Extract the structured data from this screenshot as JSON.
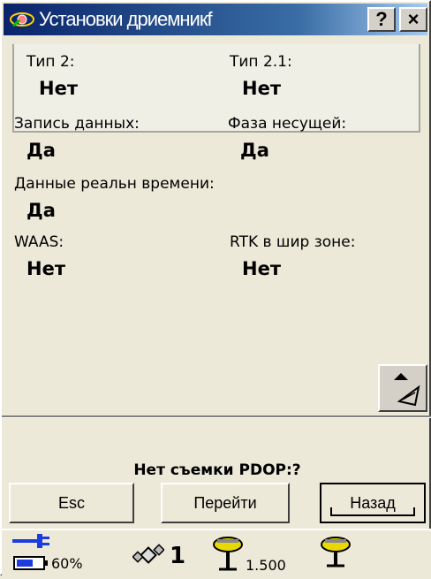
{
  "window": {
    "title": "Установки дриемникf",
    "help_label": "?",
    "close_label": "×"
  },
  "fields": {
    "type2": {
      "label": "Тип 2:",
      "value": "Нет"
    },
    "type21": {
      "label": "Тип 2.1:",
      "value": "Нет"
    },
    "data_logging": {
      "label": "Запись данных:",
      "value": "Да"
    },
    "carrier_phase": {
      "label": "Фаза несущей:",
      "value": "Да"
    },
    "realtime_data": {
      "label": "Данные реальн времени:",
      "value": "Да"
    },
    "waas": {
      "label": "WAAS:",
      "value": "Нет"
    },
    "rtk_wide": {
      "label": "RTK в шир зоне:",
      "value": "Нет"
    }
  },
  "status_text": "Нет съемки PDOP:?",
  "buttons": {
    "esc": "Esc",
    "go": "Перейти",
    "back": "Назад"
  },
  "statusbar": {
    "battery_percent": "60%",
    "satellites": "1",
    "antenna_height": "1.500"
  },
  "colors": {
    "titlebar_start": "#0a246a",
    "titlebar_end": "#a6caf0",
    "power_icon": "#1c3ce0",
    "antenna_yellow": "#e8d800"
  }
}
